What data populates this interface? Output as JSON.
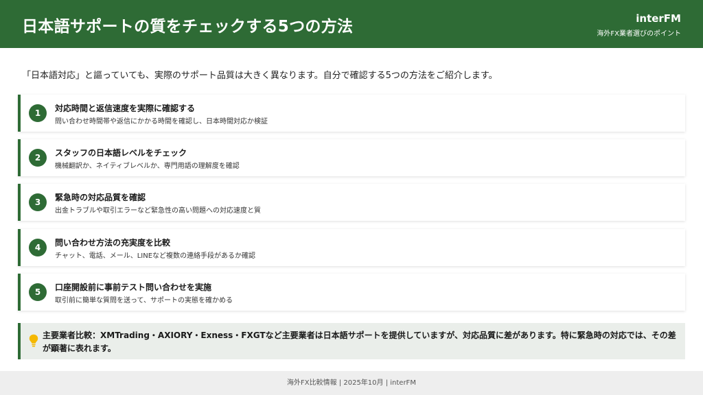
{
  "header": {
    "title": "日本語サポートの質をチェックする5つの方法",
    "brand": "interFM",
    "brand_sub": "海外FX業者選びのポイント"
  },
  "intro": "「日本語対応」と謳っていても、実際のサポート品質は大きく異なります。自分で確認する5つの方法をご紹介します。",
  "items": [
    {
      "num": "1",
      "title": "対応時間と返信速度を実際に確認する",
      "desc": "問い合わせ時間帯や返信にかかる時間を確認し、日本時間対応か検証"
    },
    {
      "num": "2",
      "title": "スタッフの日本語レベルをチェック",
      "desc": "機械翻訳か、ネイティブレベルか、専門用語の理解度を確認"
    },
    {
      "num": "3",
      "title": "緊急時の対応品質を確認",
      "desc": "出金トラブルや取引エラーなど緊急性の高い問題への対応速度と質"
    },
    {
      "num": "4",
      "title": "問い合わせ方法の充実度を比較",
      "desc": "チャット、電話、メール、LINEなど複数の連絡手段があるか確認"
    },
    {
      "num": "5",
      "title": "口座開設前に事前テスト問い合わせを実施",
      "desc": "取引前に簡単な質問を送って、サポートの実態を確かめる"
    }
  ],
  "note": {
    "icon": "lightbulb-icon",
    "text": "主要業者比較：XMTrading・AXIORY・Exness・FXGTなど主要業者は日本語サポートを提供していますが、対応品質に差があります。特に緊急時の対応では、その差が顕著に表れます。"
  },
  "footer": "海外FX比較情報 | 2025年10月 | interFM",
  "colors": {
    "brand_green": "#2e6b35",
    "note_bg": "#eaeeea",
    "icon_yellow": "#f5b800"
  }
}
